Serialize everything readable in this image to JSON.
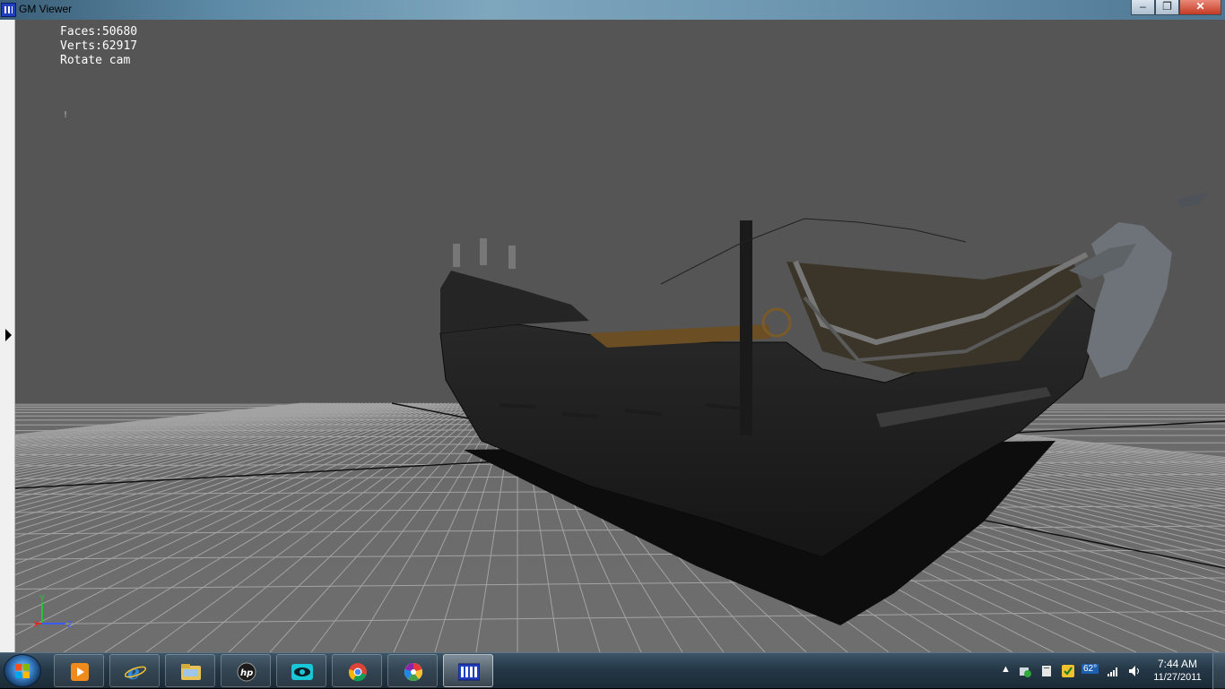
{
  "window": {
    "title": "GM Viewer",
    "minimize_glyph": "‒",
    "maximize_glyph": "❐",
    "close_glyph": "✕"
  },
  "viewport": {
    "background_color": "#555555",
    "grid_color": "#9a9a9a",
    "stats": {
      "faces": "Faces:50680",
      "verts": "Verts:62917",
      "mode": "Rotate cam"
    },
    "marker": "!",
    "axes": {
      "y_label": "Y",
      "x_label": "X",
      "z_label": "Z"
    }
  },
  "sidebar": {
    "toggle_icon": "triangle-right-icon"
  },
  "taskbar": {
    "start_icon": "windows-start-orb",
    "items": [
      {
        "name": "windows-media-player",
        "icon": "media-player-icon",
        "state": "pinned"
      },
      {
        "name": "internet-explorer",
        "icon": "ie-icon",
        "state": "pinned"
      },
      {
        "name": "windows-explorer",
        "icon": "folder-icon",
        "state": "pinned"
      },
      {
        "name": "hp-app",
        "icon": "hp-icon",
        "state": "pinned"
      },
      {
        "name": "eye-app",
        "icon": "eye-icon",
        "state": "pinned"
      },
      {
        "name": "google-chrome",
        "icon": "chrome-icon",
        "state": "pinned"
      },
      {
        "name": "picasa",
        "icon": "picasa-icon",
        "state": "pinned"
      },
      {
        "name": "gm-viewer",
        "icon": "gm-viewer-icon",
        "state": "active"
      }
    ],
    "tray": {
      "temperature": "62°",
      "time": "7:44 AM",
      "date": "11/27/2011"
    }
  }
}
